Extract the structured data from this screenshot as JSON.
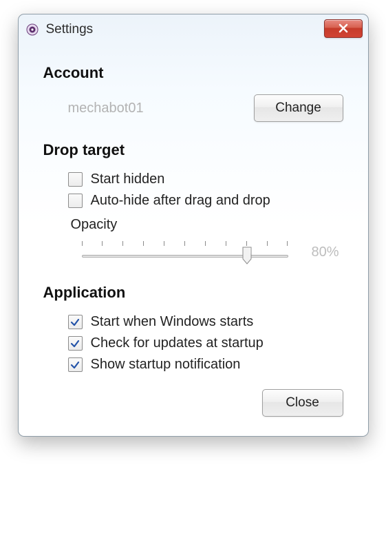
{
  "window": {
    "title": "Settings"
  },
  "sections": {
    "account": {
      "heading": "Account",
      "username": "mechabot01",
      "change_label": "Change"
    },
    "drop_target": {
      "heading": "Drop target",
      "start_hidden": {
        "label": "Start hidden",
        "checked": false
      },
      "auto_hide": {
        "label": "Auto-hide after drag and drop",
        "checked": false
      },
      "opacity": {
        "label": "Opacity",
        "value_text": "80%",
        "percent": 80,
        "ticks": 11
      }
    },
    "application": {
      "heading": "Application",
      "start_with_windows": {
        "label": "Start when Windows starts",
        "checked": true
      },
      "check_updates": {
        "label": "Check for updates at startup",
        "checked": true
      },
      "show_notification": {
        "label": "Show startup notification",
        "checked": true
      }
    }
  },
  "footer": {
    "close_label": "Close"
  }
}
